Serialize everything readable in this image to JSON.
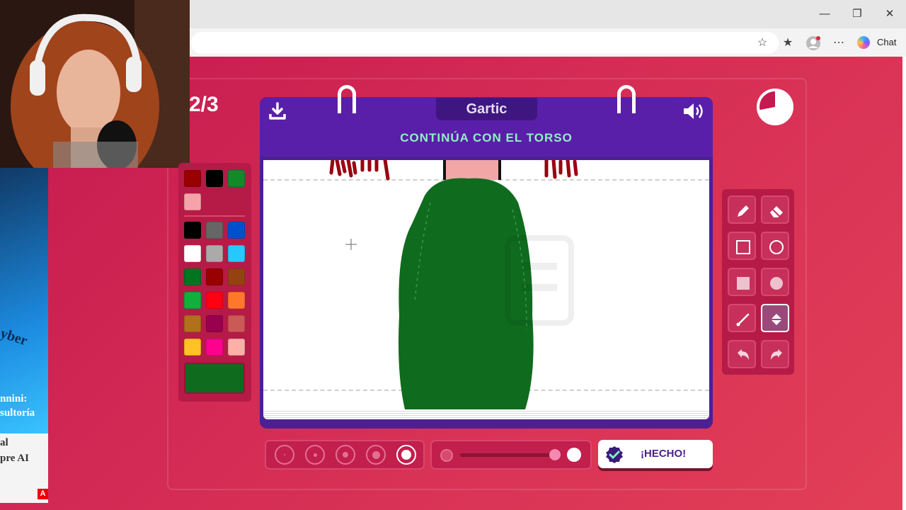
{
  "browser": {
    "chat_label": "Chat",
    "minimize_icon": "minimize-icon",
    "restore_icon": "restore-icon",
    "close_icon": "close-icon"
  },
  "game": {
    "round": "2/3",
    "logo": "Gartic",
    "prompt": "CONTINÚA CON EL TORSO",
    "done_label": "¡HECHO!",
    "timer_remaining_fraction": 0.72,
    "selected_color": "#0f6b1e",
    "selected_tool": "fill",
    "selected_brush_size_index": 4,
    "opacity_level": 1.0
  },
  "palette": {
    "recent": [
      "#990000",
      "#000000",
      "#138a2a",
      "#f5a3a8"
    ],
    "colors": [
      "#000000",
      "#666666",
      "#0050cd",
      "#ffffff",
      "#aaaaaa",
      "#26c9ff",
      "#017420",
      "#990000",
      "#964112",
      "#11b03c",
      "#ff0013",
      "#ff7829",
      "#b0701c",
      "#99004e",
      "#cb5a57",
      "#ffc126",
      "#ff008f",
      "#feafa8"
    ]
  },
  "tools": [
    {
      "name": "pencil",
      "icon": "pencil-icon"
    },
    {
      "name": "eraser",
      "icon": "eraser-icon"
    },
    {
      "name": "rectangle-outline",
      "icon": "square-outline-icon"
    },
    {
      "name": "ellipse-outline",
      "icon": "circle-outline-icon"
    },
    {
      "name": "rectangle-fill",
      "icon": "square-filled-icon"
    },
    {
      "name": "ellipse-fill",
      "icon": "circle-filled-icon"
    },
    {
      "name": "line",
      "icon": "line-icon"
    },
    {
      "name": "fill",
      "icon": "paint-bucket-icon"
    },
    {
      "name": "undo",
      "icon": "undo-icon"
    },
    {
      "name": "redo",
      "icon": "redo-icon"
    }
  ],
  "overlay_text": {
    "line1": "yber",
    "line2": "nnini:",
    "line3": "sultoría",
    "line4": "al",
    "line5": "pre AI",
    "badge": "A"
  }
}
